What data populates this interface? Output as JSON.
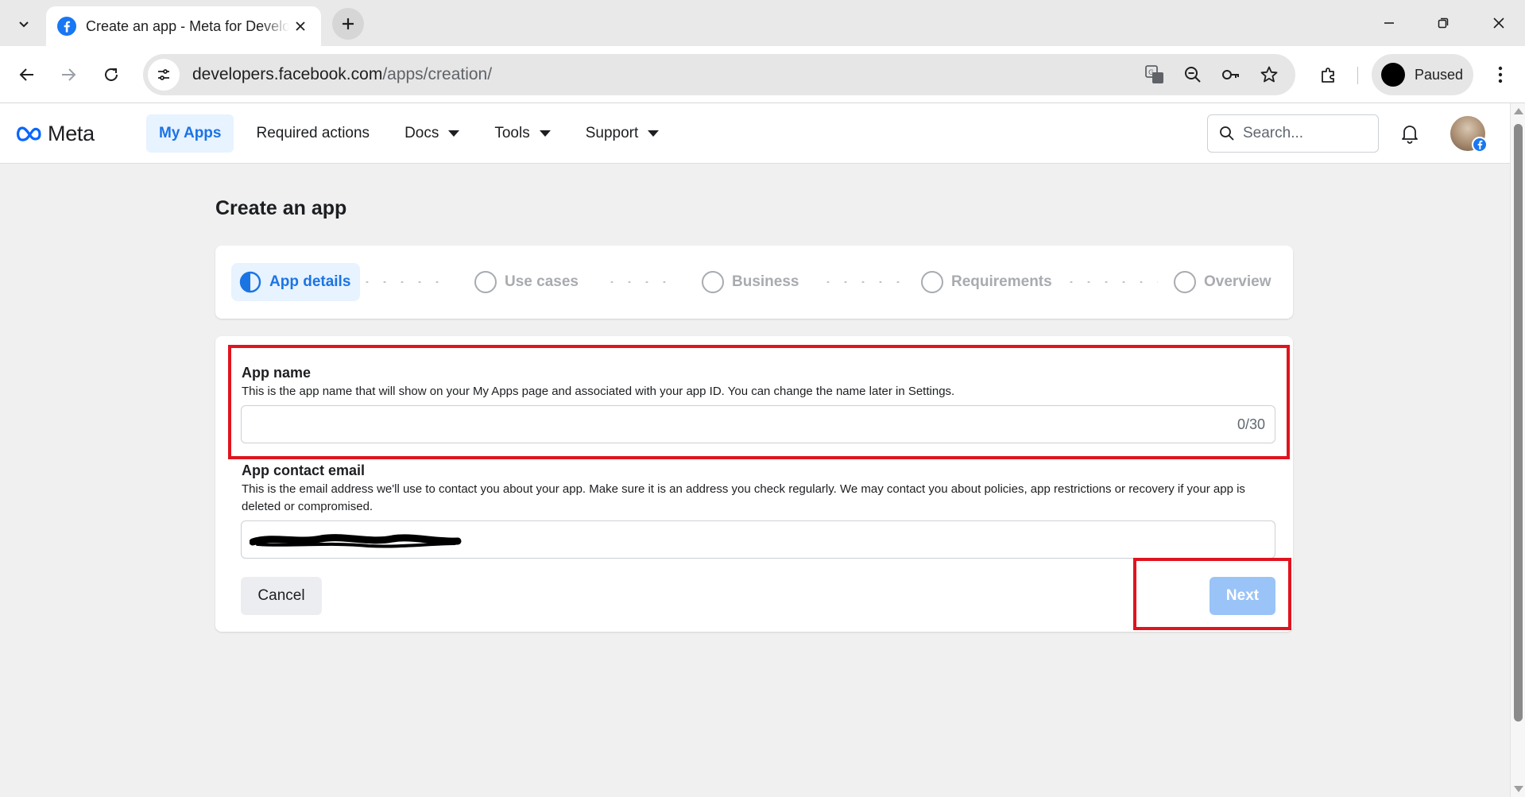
{
  "browser": {
    "tab_title": "Create an app - Meta for Developers",
    "url_host": "developers.facebook.com",
    "url_path": "/apps/creation/",
    "profile_label": "Paused"
  },
  "header": {
    "logo_text": "Meta",
    "nav": [
      {
        "label": "My Apps",
        "active": true
      },
      {
        "label": "Required actions"
      },
      {
        "label": "Docs",
        "dropdown": true
      },
      {
        "label": "Tools",
        "dropdown": true
      },
      {
        "label": "Support",
        "dropdown": true
      }
    ],
    "search_placeholder": "Search..."
  },
  "page": {
    "title": "Create an app",
    "steps": [
      {
        "label": "App details",
        "active": true
      },
      {
        "label": "Use cases"
      },
      {
        "label": "Business"
      },
      {
        "label": "Requirements"
      },
      {
        "label": "Overview"
      }
    ]
  },
  "form": {
    "app_name_label": "App name",
    "app_name_help": "This is the app name that will show on your My Apps page and associated with your app ID. You can change the name later in Settings.",
    "app_name_value": "",
    "app_name_counter": "0/30",
    "email_label": "App contact email",
    "email_help": "This is the email address we'll use to contact you about your app. Make sure it is an address you check regularly. We may contact you about policies, app restrictions or recovery if your app is deleted or compromised.",
    "cancel_label": "Cancel",
    "next_label": "Next"
  },
  "colors": {
    "accent": "#1b74e4",
    "next_disabled": "#9ac3f8",
    "highlight": "#e0141e"
  }
}
